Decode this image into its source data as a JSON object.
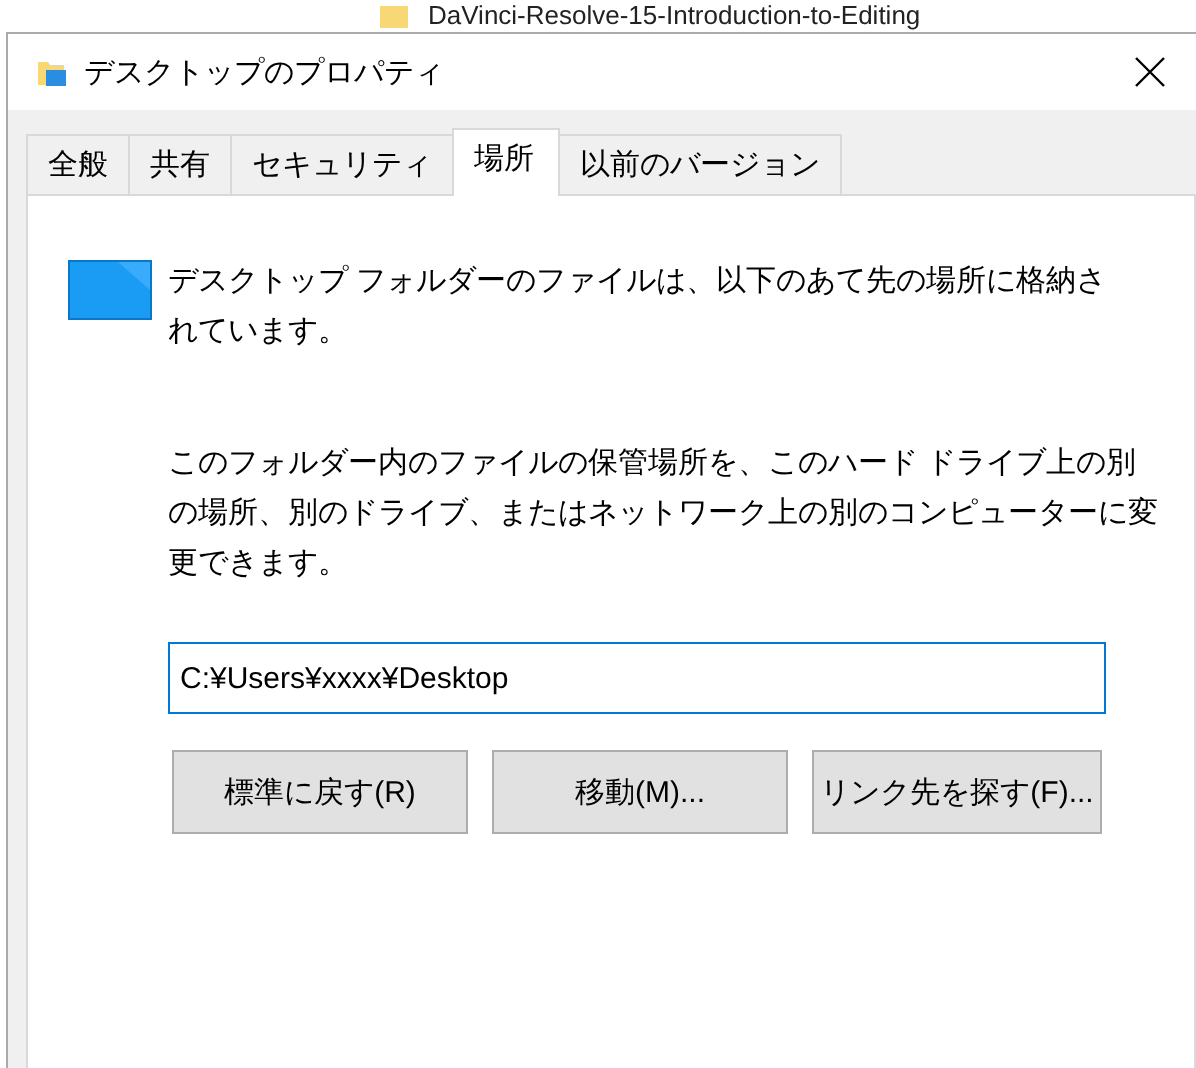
{
  "background_window": {
    "item": "DaVinci-Resolve-15-Introduction-to-Editing"
  },
  "window": {
    "title": "デスクトップのプロパティ"
  },
  "tabs": [
    {
      "label": "全般",
      "selected": false
    },
    {
      "label": "共有",
      "selected": false
    },
    {
      "label": "セキュリティ",
      "selected": false
    },
    {
      "label": "場所",
      "selected": true
    },
    {
      "label": "以前のバージョン",
      "selected": false
    }
  ],
  "location": {
    "description": "デスクトップ フォルダーのファイルは、以下のあて先の場所に格納されています。",
    "instructions": "このフォルダー内のファイルの保管場所を、このハード ドライブ上の別の場所、別のドライブ、またはネットワーク上の別のコンピューターに変更できます。",
    "path": "C:¥Users¥xxxx¥Desktop"
  },
  "buttons": [
    "標準に戻す(R)",
    "移動(M)...",
    "リンク先を探す(F)..."
  ]
}
